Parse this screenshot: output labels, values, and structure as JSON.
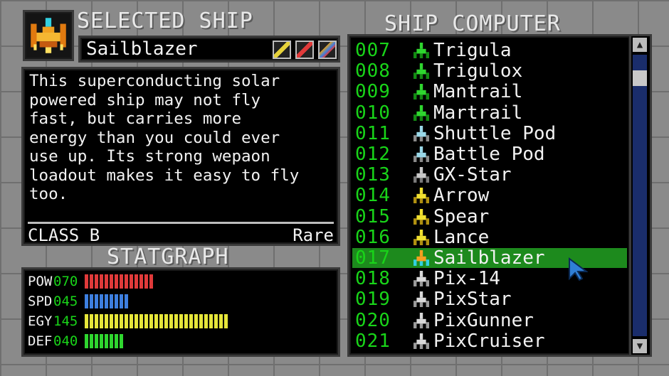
{
  "selected_ship": {
    "title": "SELECTED SHIP",
    "name": "Sailblazer",
    "description": "This superconducting solar\npowered ship may not fly\nfast, but carries more\nenergy than you could ever\nuse up. Its strong wepaon\nloadout makes it easy to fly\ntoo.",
    "class_label": "CLASS B",
    "rarity": "Rare",
    "icon": "sailblazer-ship-icon",
    "palette_swatches": [
      "yellow-pencil-icon",
      "red-pencil-icon",
      "rainbow-pencil-icon"
    ]
  },
  "statgraph": {
    "title": "STATGRAPH",
    "stats": [
      {
        "name": "POW",
        "value": "070",
        "level": 70,
        "color": "#e03a3a"
      },
      {
        "name": "SPD",
        "value": "045",
        "level": 45,
        "color": "#3d7fe0"
      },
      {
        "name": "EGY",
        "value": "145",
        "level": 145,
        "color": "#e6e63a"
      },
      {
        "name": "DEF",
        "value": "040",
        "level": 40,
        "color": "#2fd62f"
      }
    ]
  },
  "ship_computer": {
    "title": "SHIP COMPUTER",
    "selected_index": 10,
    "ships": [
      {
        "number": "007",
        "name": "Trigula",
        "icon": "green-ship-icon"
      },
      {
        "number": "008",
        "name": "Trigulox",
        "icon": "green-ship-icon"
      },
      {
        "number": "009",
        "name": "Mantrail",
        "icon": "green-ship-icon"
      },
      {
        "number": "010",
        "name": "Martrail",
        "icon": "green-ship-icon"
      },
      {
        "number": "011",
        "name": "Shuttle Pod",
        "icon": "pod-ship-icon"
      },
      {
        "number": "012",
        "name": "Battle Pod",
        "icon": "pod-ship-icon"
      },
      {
        "number": "013",
        "name": "GX-Star",
        "icon": "grey-ship-icon"
      },
      {
        "number": "014",
        "name": "Arrow",
        "icon": "yellow-ship-icon"
      },
      {
        "number": "015",
        "name": "Spear",
        "icon": "yellow-ship-icon"
      },
      {
        "number": "016",
        "name": "Lance",
        "icon": "yellow-ship-icon"
      },
      {
        "number": "017",
        "name": "Sailblazer",
        "icon": "orange-ship-icon"
      },
      {
        "number": "018",
        "name": "Pix-14",
        "icon": "pix-ship-icon"
      },
      {
        "number": "019",
        "name": "PixStar",
        "icon": "pix-ship-icon"
      },
      {
        "number": "020",
        "name": "PixGunner",
        "icon": "pix-ship-icon"
      },
      {
        "number": "021",
        "name": "PixCruiser",
        "icon": "pix-ship-icon"
      }
    ]
  },
  "colors": {
    "accent_green": "#19d419",
    "selection": "#1d8a1d",
    "scroll_track": "#1a2d6b"
  }
}
